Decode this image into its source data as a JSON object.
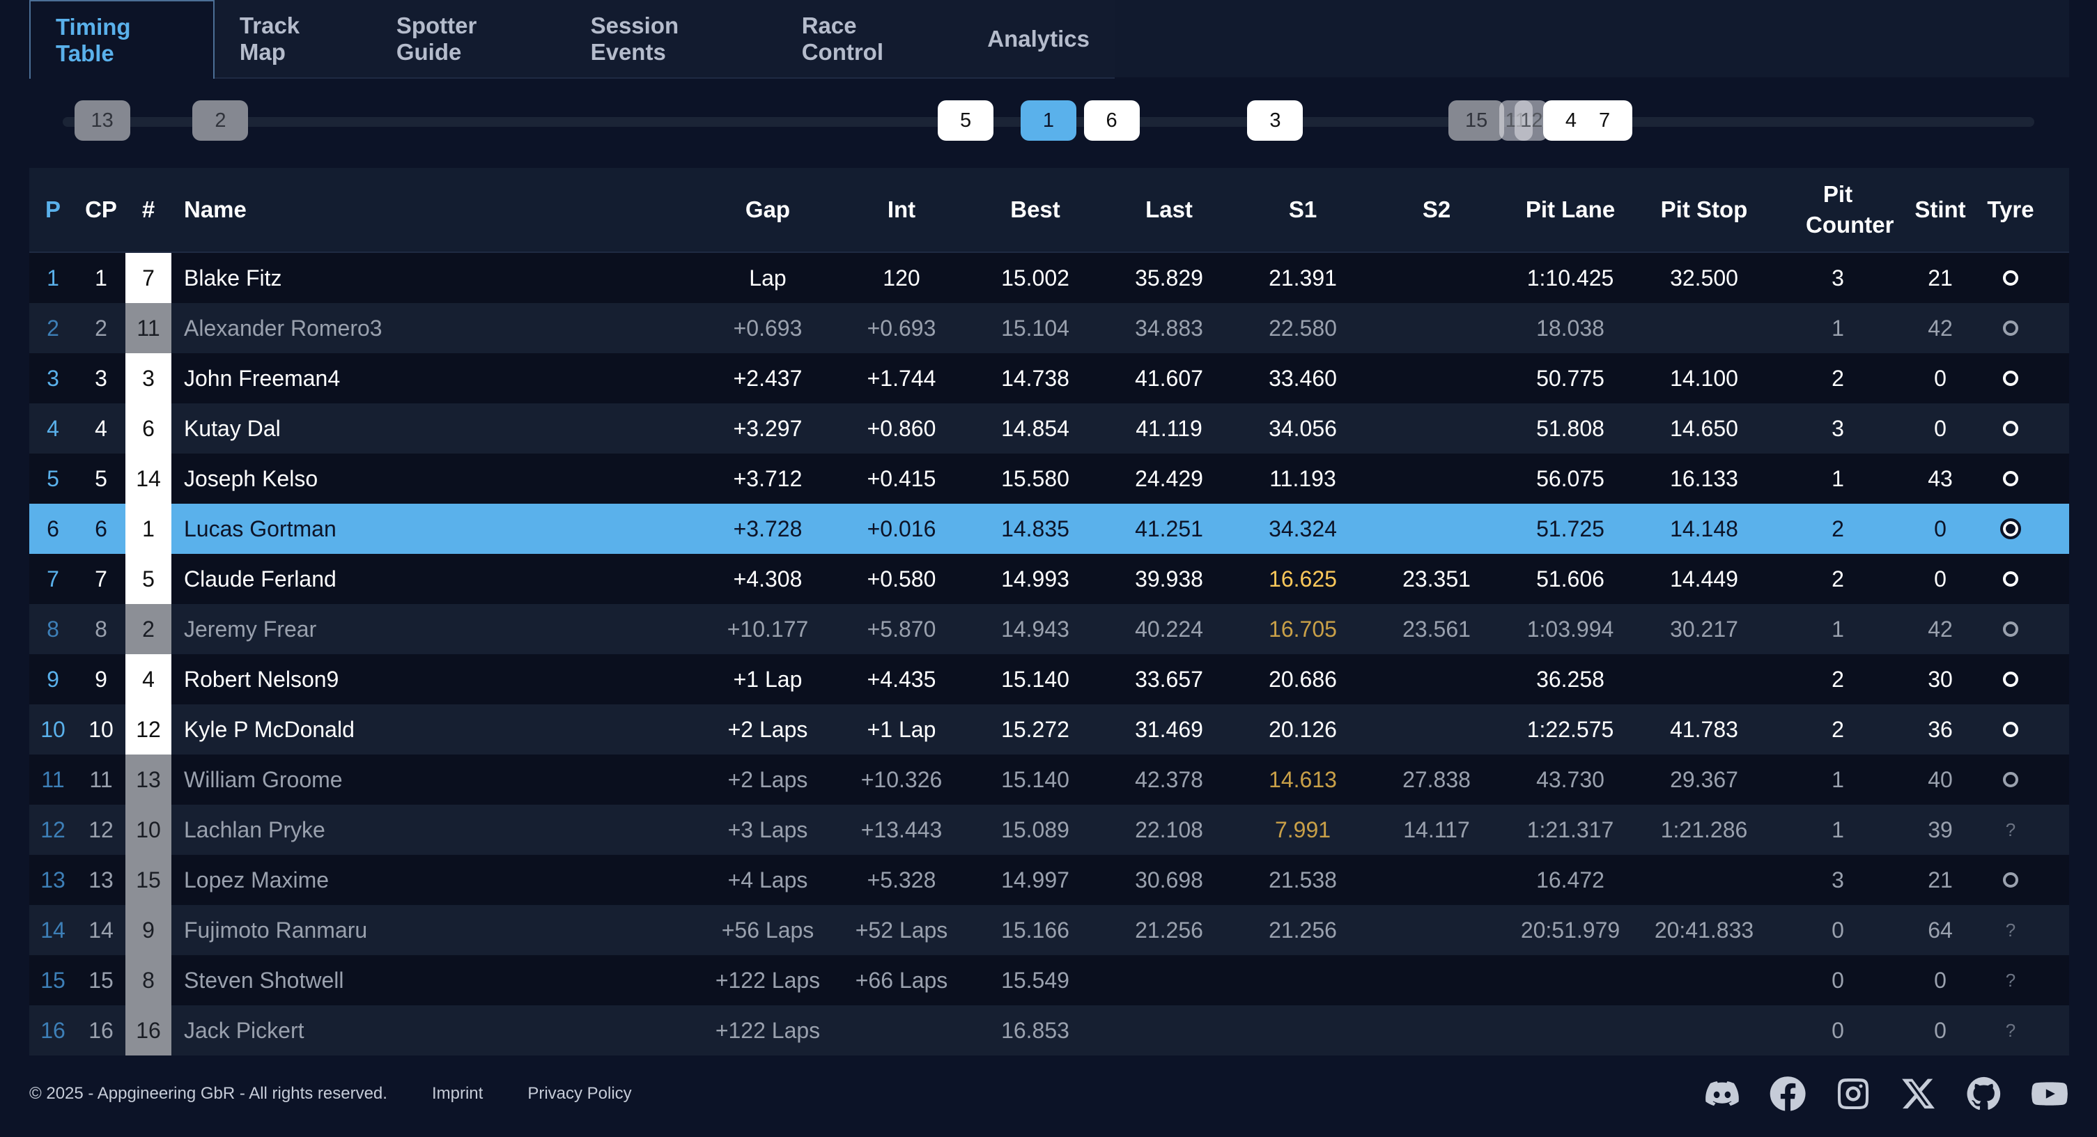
{
  "tabs": [
    {
      "label": "Timing Table",
      "active": true
    },
    {
      "label": "Track Map"
    },
    {
      "label": "Spotter Guide"
    },
    {
      "label": "Session Events"
    },
    {
      "label": "Race Control"
    },
    {
      "label": "Analytics"
    }
  ],
  "track_markers": [
    {
      "label": "13",
      "style": "grey",
      "progress": 0.02
    },
    {
      "label": "2",
      "style": "grey",
      "progress": 0.08
    },
    {
      "label": "5",
      "style": "white",
      "progress": 0.458
    },
    {
      "label": "1",
      "style": "blue",
      "progress": 0.5
    },
    {
      "label": "6",
      "style": "white",
      "progress": 0.532
    },
    {
      "label": "3",
      "style": "white",
      "progress": 0.615
    },
    {
      "label": "15",
      "style": "grey",
      "progress": 0.717
    },
    {
      "label": "11",
      "style": "ghost",
      "progress": 0.737
    },
    {
      "label": "12",
      "style": "ghost",
      "progress": 0.745
    },
    {
      "label": "4",
      "style": "white",
      "progress": 0.765
    },
    {
      "label": "7",
      "style": "white",
      "progress": 0.782
    }
  ],
  "table": {
    "headers": {
      "p": "P",
      "cp": "CP",
      "num": "#",
      "name": "Name",
      "gap": "Gap",
      "int": "Int",
      "best": "Best",
      "last": "Last",
      "s1": "S1",
      "s2": "S2",
      "pit_lane": "Pit Lane",
      "pit_stop": "Pit Stop",
      "pit_counter": "Pit Counter",
      "stint": "Stint",
      "tyre": "Tyre"
    },
    "rows": [
      {
        "p": "1",
        "cp": "1",
        "num": "7",
        "numStyle": "w",
        "name": "Blake Fitz",
        "gap": "Lap",
        "int": "120",
        "best": "15.002",
        "last": "35.829",
        "s1": "21.391",
        "s1Purple": false,
        "s2": "",
        "pit_lane": "1:10.425",
        "pit_stop": "32.500",
        "pit_counter": "3",
        "stint": "21",
        "tyre": "ring",
        "dim": false
      },
      {
        "p": "2",
        "cp": "2",
        "num": "11",
        "numStyle": "g",
        "name": "Alexander Romero3",
        "gap": "+0.693",
        "int": "+0.693",
        "best": "15.104",
        "last": "34.883",
        "s1": "22.580",
        "s1Purple": false,
        "s2": "",
        "pit_lane": "18.038",
        "pit_stop": "",
        "pit_counter": "1",
        "stint": "42",
        "tyre": "ring",
        "dim": true
      },
      {
        "p": "3",
        "cp": "3",
        "num": "3",
        "numStyle": "w",
        "name": "John Freeman4",
        "gap": "+2.437",
        "int": "+1.744",
        "best": "14.738",
        "last": "41.607",
        "s1": "33.460",
        "s1Purple": false,
        "s2": "",
        "pit_lane": "50.775",
        "pit_stop": "14.100",
        "pit_counter": "2",
        "stint": "0",
        "tyre": "ring",
        "dim": false
      },
      {
        "p": "4",
        "cp": "4",
        "num": "6",
        "numStyle": "w",
        "name": "Kutay Dal",
        "gap": "+3.297",
        "int": "+0.860",
        "best": "14.854",
        "last": "41.119",
        "s1": "34.056",
        "s1Purple": false,
        "s2": "",
        "pit_lane": "51.808",
        "pit_stop": "14.650",
        "pit_counter": "3",
        "stint": "0",
        "tyre": "ring",
        "dim": false
      },
      {
        "p": "5",
        "cp": "5",
        "num": "14",
        "numStyle": "w",
        "name": "Joseph Kelso",
        "gap": "+3.712",
        "int": "+0.415",
        "best": "15.580",
        "last": "24.429",
        "s1": "11.193",
        "s1Purple": false,
        "s2": "",
        "pit_lane": "56.075",
        "pit_stop": "16.133",
        "pit_counter": "1",
        "stint": "43",
        "tyre": "ring",
        "dim": false
      },
      {
        "p": "6",
        "cp": "6",
        "num": "1",
        "numStyle": "w",
        "name": "Lucas Gortman",
        "gap": "+3.728",
        "int": "+0.016",
        "best": "14.835",
        "last": "41.251",
        "s1": "34.324",
        "s1Purple": false,
        "s2": "",
        "pit_lane": "51.725",
        "pit_stop": "14.148",
        "pit_counter": "2",
        "stint": "0",
        "tyre": "ring",
        "dim": false,
        "selected": true
      },
      {
        "p": "7",
        "cp": "7",
        "num": "5",
        "numStyle": "w",
        "name": "Claude Ferland",
        "gap": "+4.308",
        "int": "+0.580",
        "best": "14.993",
        "last": "39.938",
        "s1": "16.625",
        "s1Purple": true,
        "s2": "23.351",
        "pit_lane": "51.606",
        "pit_stop": "14.449",
        "pit_counter": "2",
        "stint": "0",
        "tyre": "ring",
        "dim": false
      },
      {
        "p": "8",
        "cp": "8",
        "num": "2",
        "numStyle": "g",
        "name": "Jeremy Frear",
        "gap": "+10.177",
        "int": "+5.870",
        "best": "14.943",
        "last": "40.224",
        "s1": "16.705",
        "s1Purple": true,
        "s2": "23.561",
        "pit_lane": "1:03.994",
        "pit_stop": "30.217",
        "pit_counter": "1",
        "stint": "42",
        "tyre": "ring",
        "dim": true
      },
      {
        "p": "9",
        "cp": "9",
        "num": "4",
        "numStyle": "w",
        "name": "Robert Nelson9",
        "gap": "+1 Lap",
        "int": "+4.435",
        "best": "15.140",
        "last": "33.657",
        "s1": "20.686",
        "s1Purple": false,
        "s2": "",
        "pit_lane": "36.258",
        "pit_stop": "",
        "pit_counter": "2",
        "stint": "30",
        "tyre": "ring",
        "dim": false
      },
      {
        "p": "10",
        "cp": "10",
        "num": "12",
        "numStyle": "w",
        "name": "Kyle P McDonald",
        "gap": "+2 Laps",
        "int": "+1 Lap",
        "best": "15.272",
        "last": "31.469",
        "s1": "20.126",
        "s1Purple": false,
        "s2": "",
        "pit_lane": "1:22.575",
        "pit_stop": "41.783",
        "pit_counter": "2",
        "stint": "36",
        "tyre": "ring",
        "dim": false
      },
      {
        "p": "11",
        "cp": "11",
        "num": "13",
        "numStyle": "g",
        "name": "William Groome",
        "gap": "+2 Laps",
        "int": "+10.326",
        "best": "15.140",
        "last": "42.378",
        "s1": "14.613",
        "s1Purple": true,
        "s2": "27.838",
        "pit_lane": "43.730",
        "pit_stop": "29.367",
        "pit_counter": "1",
        "stint": "40",
        "tyre": "ring",
        "dim": true
      },
      {
        "p": "12",
        "cp": "12",
        "num": "10",
        "numStyle": "g",
        "name": "Lachlan Pryke",
        "gap": "+3 Laps",
        "int": "+13.443",
        "best": "15.089",
        "last": "22.108",
        "s1": "7.991",
        "s1Purple": true,
        "s2": "14.117",
        "pit_lane": "1:21.317",
        "pit_stop": "1:21.286",
        "pit_counter": "1",
        "stint": "39",
        "tyre": "?",
        "dim": true
      },
      {
        "p": "13",
        "cp": "13",
        "num": "15",
        "numStyle": "g",
        "name": "Lopez Maxime",
        "gap": "+4 Laps",
        "int": "+5.328",
        "best": "14.997",
        "last": "30.698",
        "s1": "21.538",
        "s1Purple": false,
        "s2": "",
        "pit_lane": "16.472",
        "pit_stop": "",
        "pit_counter": "3",
        "stint": "21",
        "tyre": "ring",
        "dim": true
      },
      {
        "p": "14",
        "cp": "14",
        "num": "9",
        "numStyle": "g",
        "name": "Fujimoto Ranmaru",
        "gap": "+56 Laps",
        "int": "+52 Laps",
        "best": "15.166",
        "last": "21.256",
        "s1": "21.256",
        "s1Purple": false,
        "s2": "",
        "pit_lane": "20:51.979",
        "pit_stop": "20:41.833",
        "pit_counter": "0",
        "stint": "64",
        "tyre": "?",
        "dim": true
      },
      {
        "p": "15",
        "cp": "15",
        "num": "8",
        "numStyle": "g",
        "name": "Steven Shotwell",
        "gap": "+122 Laps",
        "int": "+66 Laps",
        "best": "15.549",
        "last": "",
        "s1": "",
        "s1Purple": false,
        "s2": "",
        "pit_lane": "",
        "pit_stop": "",
        "pit_counter": "0",
        "stint": "0",
        "tyre": "?",
        "dim": true
      },
      {
        "p": "16",
        "cp": "16",
        "num": "16",
        "numStyle": "g",
        "name": "Jack Pickert",
        "gap": "+122 Laps",
        "int": "",
        "best": "16.853",
        "last": "",
        "s1": "",
        "s1Purple": false,
        "s2": "",
        "pit_lane": "",
        "pit_stop": "",
        "pit_counter": "0",
        "stint": "0",
        "tyre": "?",
        "dim": true
      }
    ]
  },
  "footer": {
    "copyright": "© 2025 - Appgineering GbR - All rights reserved.",
    "imprint": "Imprint",
    "privacy": "Privacy Policy",
    "social_icons": [
      "discord-icon",
      "facebook-icon",
      "instagram-icon",
      "x-icon",
      "github-icon",
      "youtube-icon"
    ]
  },
  "colors": {
    "accent": "#5ab1eb",
    "background": "#0c1327",
    "purple_sector": "#fbc85a"
  }
}
